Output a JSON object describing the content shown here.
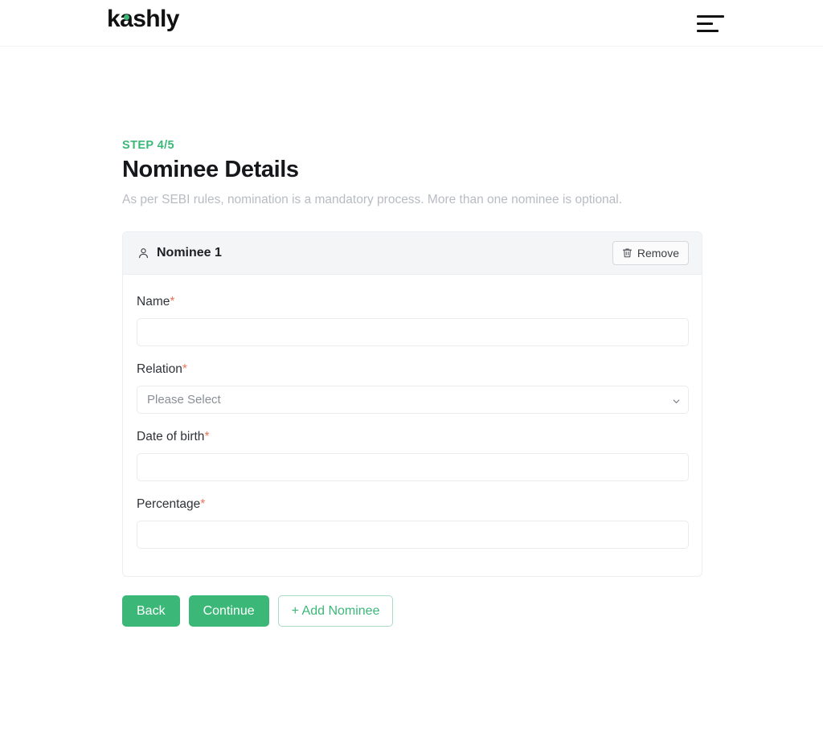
{
  "header": {
    "brand_before": "k",
    "brand_a": "a",
    "brand_after": "shly",
    "brand_full": "kashly",
    "menu_icon": "hamburger-menu-icon"
  },
  "main": {
    "step_label": "STEP 4/5",
    "title": "Nominee Details",
    "subtitle": "As per SEBI rules, nomination is a mandatory process. More than one nominee is optional."
  },
  "nominee_card": {
    "header": {
      "icon": "person-icon",
      "title": "Nominee 1",
      "remove_label": "Remove",
      "remove_icon": "trash-icon"
    },
    "fields": [
      {
        "label": "Name",
        "required_mark": "*",
        "type": "text",
        "value": "",
        "placeholder": ""
      },
      {
        "label": "Relation",
        "required_mark": "*",
        "type": "select",
        "value": "Please Select",
        "options": [
          "Please Select"
        ],
        "chevron_icon": "chevron-down-icon"
      },
      {
        "label": "Date of birth",
        "required_mark": "*",
        "type": "text",
        "value": "",
        "placeholder": ""
      },
      {
        "label": "Percentage",
        "required_mark": "*",
        "type": "text",
        "value": "",
        "placeholder": ""
      }
    ]
  },
  "actions": {
    "back_label": "Back",
    "continue_label": "Continue",
    "add_nominee_label": "+ Add Nominee"
  },
  "colors": {
    "accent_green": "#3bb878",
    "required_red": "#e8735a",
    "title_black": "#15171a",
    "subtitle_gray": "#b8bcc2",
    "card_header_bg": "#f4f5f6",
    "border_gray": "#e9ebee"
  }
}
